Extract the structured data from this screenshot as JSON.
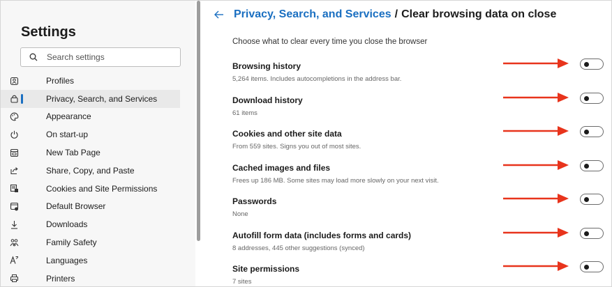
{
  "sidebar": {
    "title": "Settings",
    "search_placeholder": "Search settings",
    "items": [
      {
        "label": "Profiles",
        "icon": "profile-icon",
        "active": false
      },
      {
        "label": "Privacy, Search, and Services",
        "icon": "lock-icon",
        "active": true
      },
      {
        "label": "Appearance",
        "icon": "palette-icon",
        "active": false
      },
      {
        "label": "On start-up",
        "icon": "power-icon",
        "active": false
      },
      {
        "label": "New Tab Page",
        "icon": "new-tab-icon",
        "active": false
      },
      {
        "label": "Share, Copy, and Paste",
        "icon": "share-icon",
        "active": false
      },
      {
        "label": "Cookies and Site Permissions",
        "icon": "cookies-icon",
        "active": false
      },
      {
        "label": "Default Browser",
        "icon": "browser-icon",
        "active": false
      },
      {
        "label": "Downloads",
        "icon": "download-icon",
        "active": false
      },
      {
        "label": "Family Safety",
        "icon": "family-icon",
        "active": false
      },
      {
        "label": "Languages",
        "icon": "languages-icon",
        "active": false
      },
      {
        "label": "Printers",
        "icon": "printer-icon",
        "active": false
      }
    ]
  },
  "header": {
    "breadcrumb_link": "Privacy, Search, and Services",
    "separator": "/",
    "current": "Clear browsing data on close"
  },
  "subtitle": "Choose what to clear every time you close the browser",
  "options": [
    {
      "title": "Browsing history",
      "desc": "5,264 items. Includes autocompletions in the address bar.",
      "enabled": false
    },
    {
      "title": "Download history",
      "desc": "61 items",
      "enabled": false
    },
    {
      "title": "Cookies and other site data",
      "desc": "From 559 sites. Signs you out of most sites.",
      "enabled": false
    },
    {
      "title": "Cached images and files",
      "desc": "Frees up 186 MB. Some sites may load more slowly on your next visit.",
      "enabled": false
    },
    {
      "title": "Passwords",
      "desc": "None",
      "enabled": false
    },
    {
      "title": "Autofill form data (includes forms and cards)",
      "desc": "8 addresses, 445 other suggestions (synced)",
      "enabled": false
    },
    {
      "title": "Site permissions",
      "desc": "7 sites",
      "enabled": false
    }
  ],
  "colors": {
    "accent": "#1a6fc1",
    "arrow": "#e8341c",
    "sidebar_bg": "#f7f7f7",
    "active_bg": "#e9e9e9"
  }
}
